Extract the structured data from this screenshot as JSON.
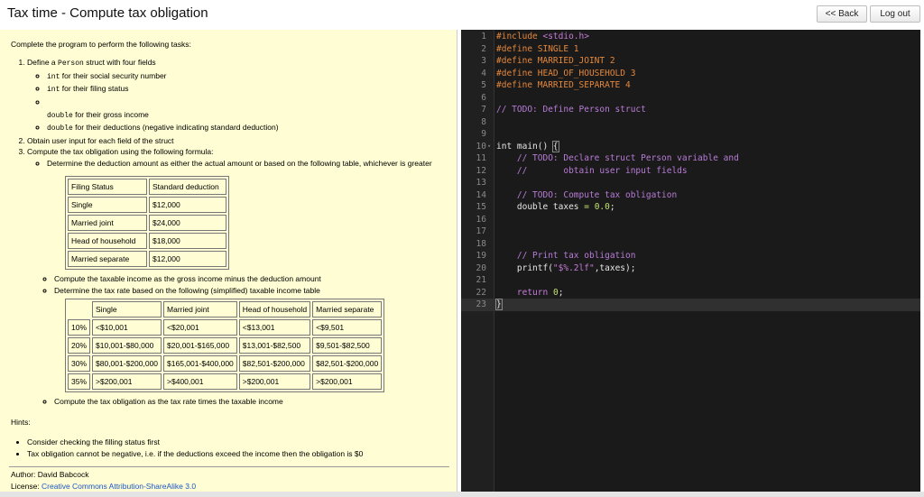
{
  "app": {
    "title": "Tax time - Compute tax obligation",
    "back_label": "<< Back",
    "logout_label": "Log out"
  },
  "instructions": {
    "intro": "Complete the program to perform the following tasks:",
    "task1": {
      "pre": "Define a ",
      "code": "Person",
      "post": " struct with four fields"
    },
    "fields": [
      {
        "code": "int",
        "text": " for their social security number"
      },
      {
        "code": "int",
        "text": " for their filing status"
      },
      {
        "code": "",
        "text": ""
      },
      {
        "code": "double",
        "text": " for their gross income"
      },
      {
        "code": "double",
        "text": " for their deductions (negative indicating standard deduction)"
      }
    ],
    "task2": "Obtain user input for each field of the struct",
    "task3": "Compute the tax obligation using the following formula:",
    "step1": "Determine the deduction amount as either the actual amount or based on the following table, whichever is greater",
    "step2": "Compute the taxable income as the gross income minus the deduction amount",
    "step3": "Determine the tax rate based on the following (simplified) taxable income table",
    "step4": "Compute the tax obligation as the tax rate times the taxable income"
  },
  "deduction_table": {
    "headers": [
      "Filing Status",
      "Standard deduction"
    ],
    "rows": [
      [
        "Single",
        "$12,000"
      ],
      [
        "Married joint",
        "$24,000"
      ],
      [
        "Head of household",
        "$18,000"
      ],
      [
        "Married separate",
        "$12,000"
      ]
    ]
  },
  "rate_table": {
    "headers": [
      "",
      "Single",
      "Married joint",
      "Head of household",
      "Married separate"
    ],
    "rows": [
      [
        "10%",
        "<$10,001",
        "<$20,001",
        "<$13,001",
        "<$9,501"
      ],
      [
        "20%",
        "$10,001-$80,000",
        "$20,001-$165,000",
        "$13,001-$82,500",
        "$9,501-$82,500"
      ],
      [
        "30%",
        "$80,001-$200,000",
        "$165,001-$400,000",
        "$82,501-$200,000",
        "$82,501-$200,000"
      ],
      [
        "35%",
        ">$200,001",
        ">$400,001",
        ">$200,001",
        ">$200,001"
      ]
    ]
  },
  "hints": {
    "label": "Hints:",
    "items": [
      "Consider checking the filling status first",
      "Tax obligation cannot be negative, i.e. if the deductions exceed the income then the obligation is $0"
    ]
  },
  "footer": {
    "author": "Author: David Babcock",
    "license_label": "License: ",
    "license_link": "Creative Commons Attribution-ShareAlike 3.0"
  },
  "editor": {
    "lines": [
      {
        "n": "1",
        "fold": "",
        "tokens": [
          [
            "pp",
            "#include "
          ],
          [
            "str",
            "<stdio.h>"
          ]
        ]
      },
      {
        "n": "2",
        "fold": "",
        "tokens": [
          [
            "pp",
            "#define SINGLE 1"
          ]
        ]
      },
      {
        "n": "3",
        "fold": "",
        "tokens": [
          [
            "pp",
            "#define MARRIED_JOINT 2"
          ]
        ]
      },
      {
        "n": "4",
        "fold": "",
        "tokens": [
          [
            "pp",
            "#define HEAD_OF_HOUSEHOLD 3"
          ]
        ]
      },
      {
        "n": "5",
        "fold": "",
        "tokens": [
          [
            "pp",
            "#define MARRIED_SEPARATE 4"
          ]
        ]
      },
      {
        "n": "6",
        "fold": "",
        "tokens": []
      },
      {
        "n": "7",
        "fold": "",
        "tokens": [
          [
            "cm",
            "// TODO: Define Person struct"
          ]
        ]
      },
      {
        "n": "8",
        "fold": "",
        "tokens": []
      },
      {
        "n": "9",
        "fold": "",
        "tokens": []
      },
      {
        "n": "10",
        "fold": "▾",
        "tokens": [
          [
            "kw",
            "int main() "
          ],
          [
            "brk",
            "{"
          ]
        ]
      },
      {
        "n": "11",
        "fold": "",
        "tokens": [
          [
            "cm",
            "    // TODO: Declare struct Person variable and"
          ]
        ]
      },
      {
        "n": "12",
        "fold": "",
        "tokens": [
          [
            "cm",
            "    //       obtain user input fields"
          ]
        ]
      },
      {
        "n": "13",
        "fold": "",
        "tokens": []
      },
      {
        "n": "14",
        "fold": "",
        "tokens": [
          [
            "cm",
            "    // TODO: Compute tax obligation"
          ]
        ]
      },
      {
        "n": "15",
        "fold": "",
        "tokens": [
          [
            "kw",
            "    double taxes "
          ],
          [
            "op",
            "="
          ],
          [
            "kw",
            " "
          ],
          [
            "num",
            "0.0"
          ],
          [
            "kw",
            ";"
          ]
        ]
      },
      {
        "n": "16",
        "fold": "",
        "tokens": []
      },
      {
        "n": "17",
        "fold": "",
        "tokens": []
      },
      {
        "n": "18",
        "fold": "",
        "tokens": []
      },
      {
        "n": "19",
        "fold": "",
        "tokens": [
          [
            "cm",
            "    // Print tax obligation"
          ]
        ]
      },
      {
        "n": "20",
        "fold": "",
        "tokens": [
          [
            "kw",
            "    printf("
          ],
          [
            "str",
            "\"$%.2lf\""
          ],
          [
            "kw",
            ",taxes);"
          ]
        ]
      },
      {
        "n": "21",
        "fold": "",
        "tokens": []
      },
      {
        "n": "22",
        "fold": "",
        "tokens": [
          [
            "kw",
            "    "
          ],
          [
            "str",
            "return"
          ],
          [
            "kw",
            " "
          ],
          [
            "num",
            "0"
          ],
          [
            "kw",
            ";"
          ]
        ]
      },
      {
        "n": "23",
        "fold": "",
        "tokens": [
          [
            "brk",
            "}"
          ]
        ],
        "active": true
      }
    ]
  },
  "colors": {
    "instructions_bg": "#fffdd3",
    "editor_bg": "#1a1a1a",
    "preprocessor": "#e4873b",
    "comment": "#b77cd6",
    "number": "#c3e36e",
    "link": "#1a55c8"
  }
}
